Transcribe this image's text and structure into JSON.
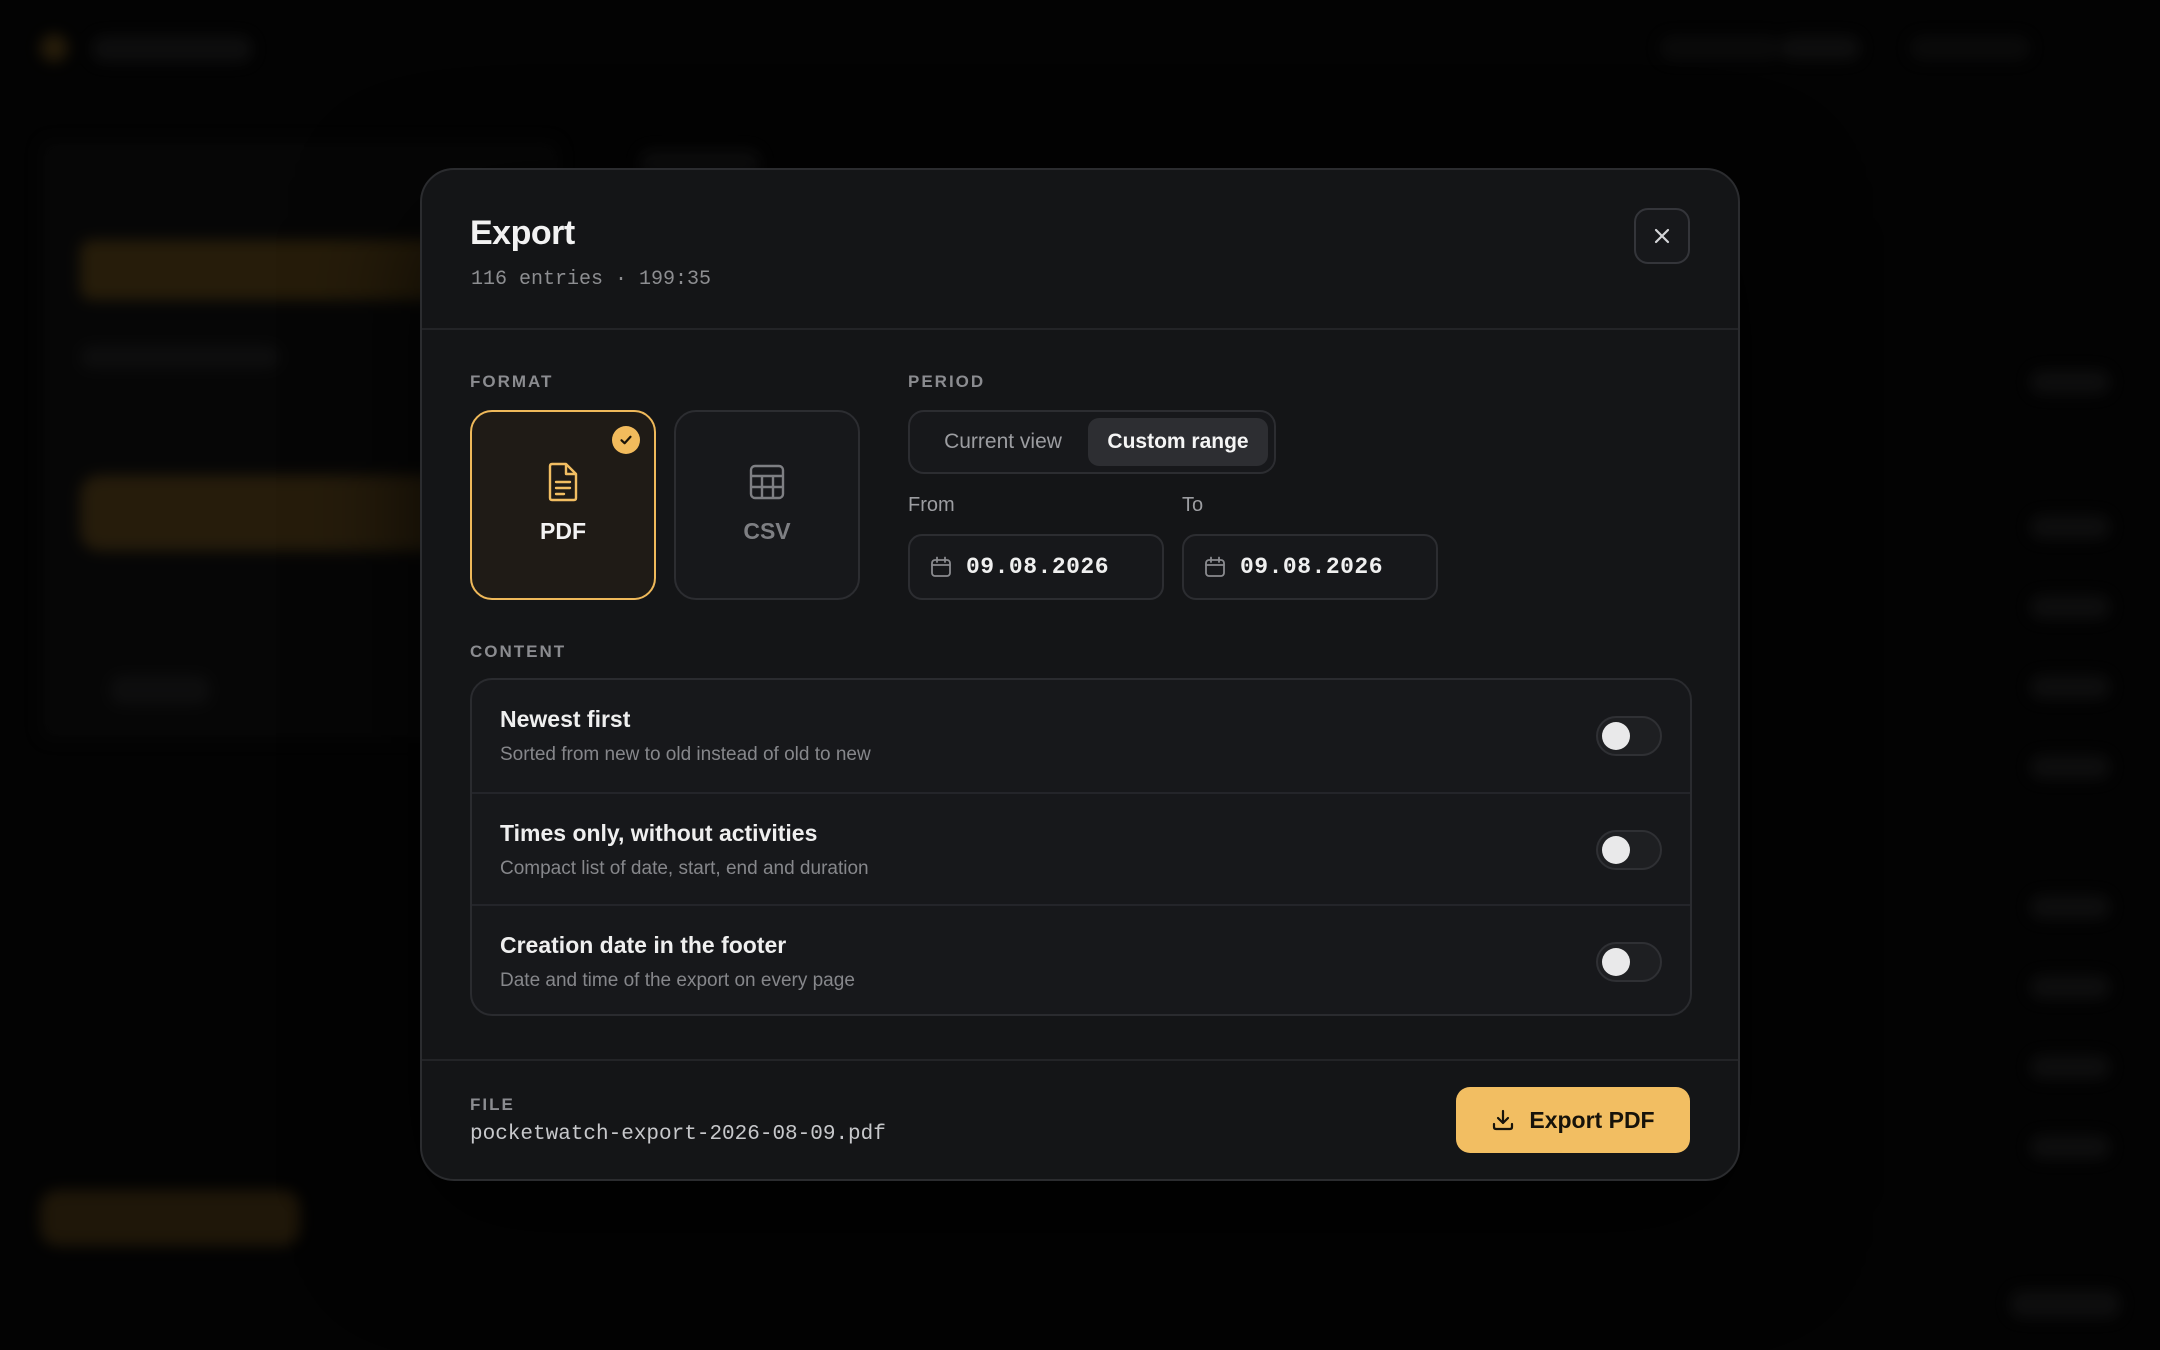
{
  "modal": {
    "title": "Export",
    "subtitle": "116 entries · 199:35"
  },
  "format": {
    "label": "FORMAT",
    "options": [
      {
        "label": "PDF",
        "icon": "file-text-icon",
        "selected": true
      },
      {
        "label": "CSV",
        "icon": "table-icon",
        "selected": false
      }
    ]
  },
  "period": {
    "label": "PERIOD",
    "options": [
      "Current view",
      "Custom range"
    ],
    "selected": "Custom range",
    "from_label": "From",
    "from_value": "09.08.2026",
    "to_label": "To",
    "to_value": "09.08.2026"
  },
  "content": {
    "label": "CONTENT",
    "items": [
      {
        "title": "Newest first",
        "description": "Sorted from new to old instead of old to new",
        "enabled": false
      },
      {
        "title": "Times only, without activities",
        "description": "Compact list of date, start, end and duration",
        "enabled": false
      },
      {
        "title": "Creation date in the footer",
        "description": "Date and time of the export on every page",
        "enabled": false
      }
    ]
  },
  "file": {
    "label": "FILE",
    "name": "pocketwatch-export-2026-08-09.pdf"
  },
  "actions": {
    "export_label": "Export PDF"
  },
  "colors": {
    "accent": "#f2be62",
    "background": "#141517"
  }
}
